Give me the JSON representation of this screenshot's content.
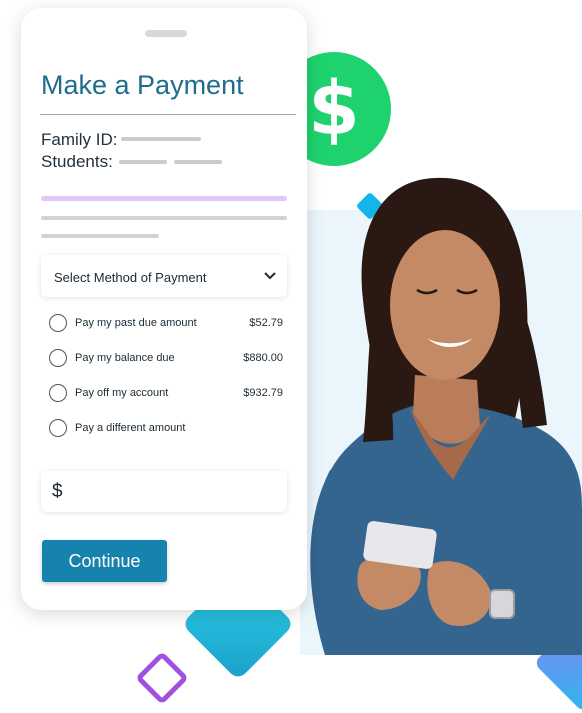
{
  "payment_card": {
    "title": "Make a Payment",
    "family_id_label": "Family ID:",
    "students_label": "Students:",
    "select_method_label": "Select Method of Payment",
    "options": [
      {
        "label": "Pay my past due amount",
        "amount": "$52.79"
      },
      {
        "label": "Pay my balance due",
        "amount": "$880.00"
      },
      {
        "label": "Pay off my account",
        "amount": "$932.79"
      },
      {
        "label": "Pay a different amount",
        "amount": ""
      }
    ],
    "currency_symbol": "$",
    "continue_label": "Continue"
  },
  "coin_symbol": "$",
  "colors": {
    "accent_blue": "#1683ae",
    "title_blue": "#1f6c8d",
    "coin_green": "#1ed36e",
    "diamond_cyan": "#12b6ea",
    "outline_purple": "#a14fe0"
  },
  "icons": [
    "dollar-coin-icon",
    "chevron-down-icon",
    "radio-icon"
  ]
}
